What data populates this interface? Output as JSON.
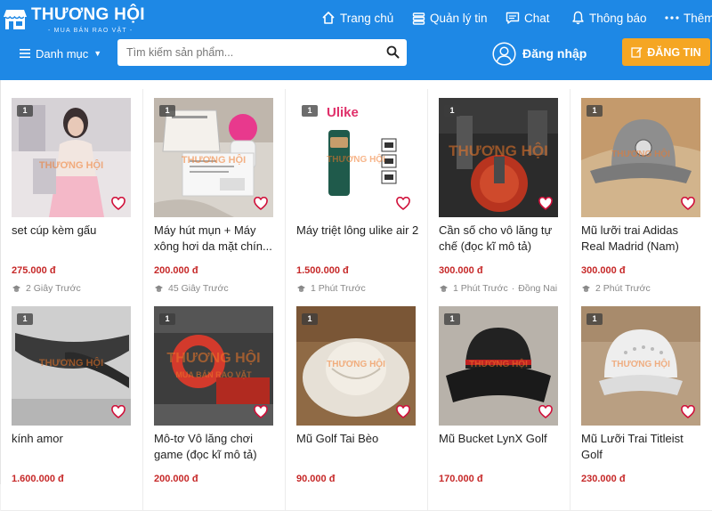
{
  "brand": {
    "name": "THƯƠNG HỘI",
    "tagline": "- MUA BÁN RAO VẶT -",
    "color_primary": "#1e88e5",
    "color_accent": "#f5a623",
    "color_price": "#c62828"
  },
  "nav": {
    "home": "Trang chủ",
    "manage": "Quản lý tin",
    "chat": "Chat",
    "notify": "Thông báo",
    "more": "Thêm"
  },
  "toolbar": {
    "category_label": "Danh mục",
    "search_placeholder": "Tìm kiếm sản phẩm...",
    "login_label": "Đăng nhập",
    "post_label": "ĐĂNG TIN"
  },
  "products": [
    {
      "title": "set cúp kèm gấu",
      "price": "275.000 đ",
      "time": "2 Giây Trước",
      "location": "",
      "image_count": "1"
    },
    {
      "title": "Máy hút mụn + Máy xông hơi da mặt chín...",
      "price": "200.000 đ",
      "time": "45 Giây Trước",
      "location": "",
      "image_count": "1"
    },
    {
      "title": "Máy triệt lông ulike air 2",
      "price": "1.500.000 đ",
      "time": "1 Phút Trước",
      "location": "",
      "image_count": "1",
      "image_text": "Ulike"
    },
    {
      "title": "Cần số cho vô lăng tự chế (đọc kĩ mô tả)",
      "price": "300.000 đ",
      "time": "1 Phút Trước",
      "location": "Đồng Nai",
      "image_count": "1"
    },
    {
      "title": "Mũ lưỡi trai Adidas Real Madrid (Nam)",
      "price": "300.000 đ",
      "time": "2 Phút Trước",
      "location": "",
      "image_count": "1"
    },
    {
      "title": "kính amor",
      "price": "1.600.000 đ",
      "time": "",
      "location": "",
      "image_count": "1"
    },
    {
      "title": "Mô-tơ Vô lăng chơi game (đọc kĩ mô tả)",
      "price": "200.000 đ",
      "time": "",
      "location": "",
      "image_count": "1"
    },
    {
      "title": "Mũ Golf Tai Bèo",
      "price": "90.000 đ",
      "time": "",
      "location": "",
      "image_count": "1"
    },
    {
      "title": "Mũ Bucket LynX Golf",
      "price": "170.000 đ",
      "time": "",
      "location": "",
      "image_count": "1"
    },
    {
      "title": "Mũ Lưỡi Trai Titleist Golf",
      "price": "230.000 đ",
      "time": "",
      "location": "",
      "image_count": "1"
    }
  ],
  "watermark": {
    "name": "THƯƠNG HỘI",
    "tagline": "MUA BÁN RAO VẶT"
  },
  "icons": [
    "home-icon",
    "list-icon",
    "chat-icon",
    "bell-icon",
    "more-icon",
    "hamburger-icon",
    "search-icon",
    "user-icon",
    "edit-icon",
    "heart-icon",
    "images-count-icon",
    "hat-icon"
  ]
}
